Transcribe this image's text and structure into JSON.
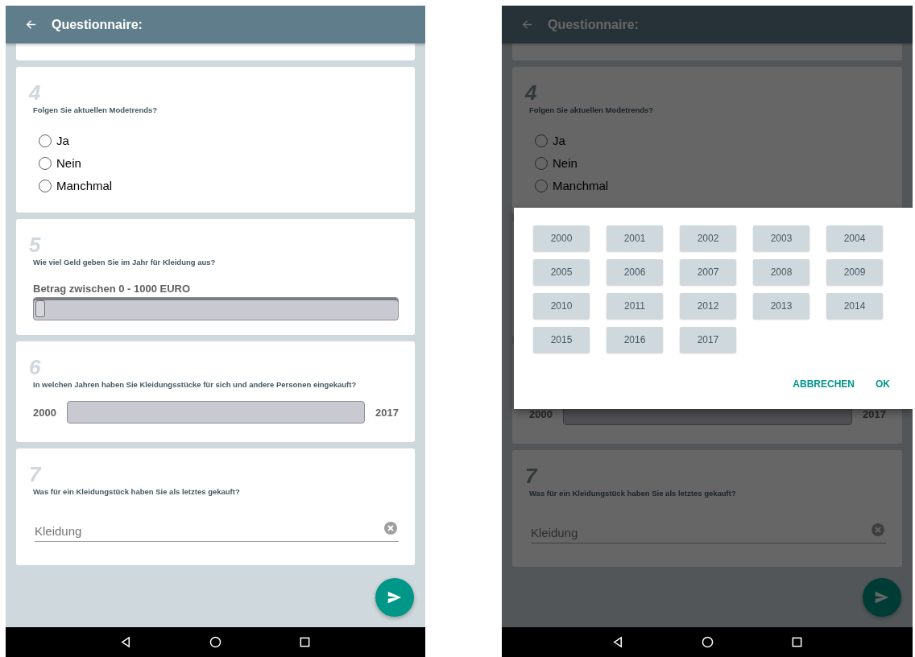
{
  "screens": [
    {
      "title": "Questionnaire:",
      "questions": [
        {
          "kind": "choice",
          "number": "4",
          "text": "Folgen Sie aktuellen Modetrends?",
          "options": [
            {
              "label": "Ja",
              "selected": false
            },
            {
              "label": "Nein",
              "selected": false
            },
            {
              "label": "Manchmal",
              "selected": false
            }
          ]
        },
        {
          "kind": "slider",
          "number": "5",
          "text": "Wie viel Geld geben Sie im Jahr für Kleidung aus?",
          "label": "Betrag zwischen 0 - 1000 EURO",
          "level": 0
        },
        {
          "kind": "range",
          "number": "6",
          "text": "In welchen Jahren haben Sie Kleidungsstücke für sich und andere Personen eingekauft?",
          "min_label": "2000",
          "max_label": "2017",
          "level": 0
        },
        {
          "kind": "text",
          "number": "7",
          "text": "Was für ein Kleidungstück haben Sie als letztes gekauft?",
          "placeholder": "Kleidung"
        }
      ]
    },
    {
      "title": "Questionnaire:",
      "questions": [
        {
          "kind": "choice",
          "number": "4",
          "text": "Folgen Sie aktuellen Modetrends?",
          "options": [
            {
              "label": "Ja",
              "selected": false
            },
            {
              "label": "Nein",
              "selected": false
            },
            {
              "label": "Manchmal",
              "selected": false
            }
          ]
        },
        {
          "kind": "slider"
        },
        {
          "kind": "range",
          "min_label": "2000",
          "max_label": "2017",
          "level": 0
        },
        {
          "kind": "text",
          "number": "7",
          "text": "Was für ein Kleidungstück haben Sie als letztes gekauft?",
          "placeholder": "Kleidung"
        }
      ],
      "dialog": {
        "years": [
          "2000",
          "2001",
          "2002",
          "2003",
          "2004",
          "2005",
          "2006",
          "2007",
          "2008",
          "2009",
          "2010",
          "2011",
          "2012",
          "2013",
          "2014",
          "2015",
          "2016",
          "2017"
        ],
        "buttons": [
          "ABBRECHEN",
          "OK"
        ]
      }
    }
  ]
}
